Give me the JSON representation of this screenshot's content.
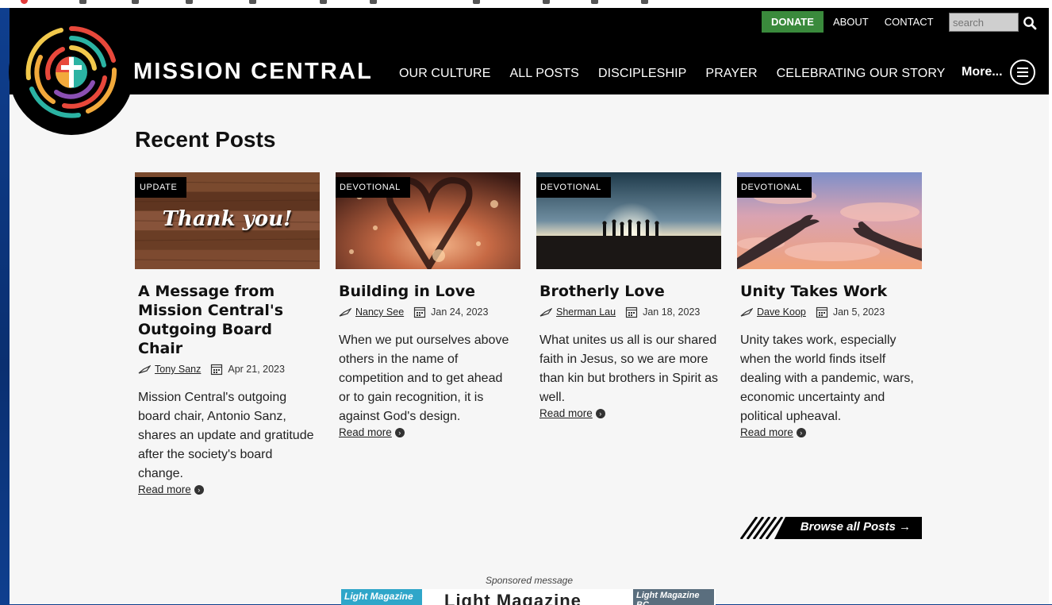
{
  "site": {
    "brand": "MISSION CENTRAL",
    "colors": {
      "header_bg": "#000000",
      "donate_bg": "#3a8a3c",
      "page_bg": "#f6f6f6"
    }
  },
  "utility_nav": {
    "donate": "DONATE",
    "about": "ABOUT",
    "contact": "CONTACT",
    "search_placeholder": "search"
  },
  "main_nav": {
    "items": [
      "OUR CULTURE",
      "ALL POSTS",
      "DISCIPLESHIP",
      "PRAYER",
      "CELEBRATING OUR STORY"
    ],
    "more": "More..."
  },
  "recent": {
    "title": "Recent Posts",
    "posts": [
      {
        "badge": "UPDATE",
        "image_text": "Thank you!",
        "title": "A Message from Mission Central's Outgoing Board Chair",
        "author": "Tony Sanz",
        "date": "Apr 21, 2023",
        "excerpt": "Mission Central's outgoing board chair, Antonio Sanz, shares an update and gratitude after the society's board change.",
        "read_more": "Read more"
      },
      {
        "badge": "DEVOTIONAL",
        "title": "Building in Love",
        "author": "Nancy See",
        "date": "Jan 24, 2023",
        "excerpt": "When we put ourselves above others in the name of competition and to get ahead or to gain recognition, it is against God's design.",
        "read_more": "Read more"
      },
      {
        "badge": "DEVOTIONAL",
        "title": "Brotherly Love",
        "author": "Sherman Lau",
        "date": "Jan 18, 2023",
        "excerpt": "What unites us all is our shared faith in Jesus, so we are more than kin but brothers in Spirit as well.",
        "read_more": "Read more"
      },
      {
        "badge": "DEVOTIONAL",
        "title": "Unity Takes Work",
        "author": "Dave Koop",
        "date": "Jan 5, 2023",
        "excerpt": "Unity takes work, especially when the world finds itself dealing with a pandemic, wars, economic uncertainty and political upheaval.",
        "read_more": "Read more"
      }
    ],
    "browse_all": "Browse all Posts →"
  },
  "sponsored": {
    "label": "Sponsored message",
    "ad_title": "Light Magazine",
    "mag_left": "Light Magazine",
    "mag_right": "Light Magazine BC"
  }
}
